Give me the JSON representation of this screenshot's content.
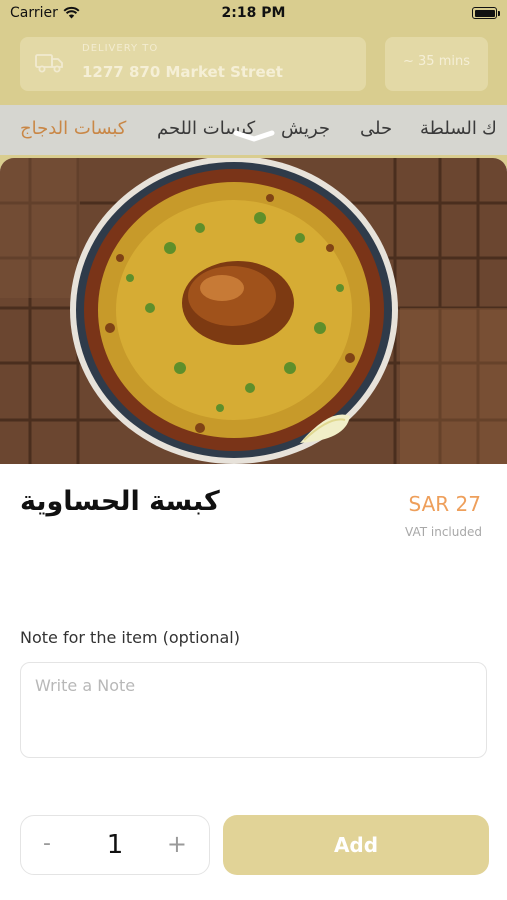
{
  "status_bar": {
    "carrier": "Carrier",
    "time": "2:18 PM"
  },
  "header": {
    "delivery_label": "DELIVERY TO",
    "delivery_address": "1277 870 Market Street",
    "delivery_time": "~ 35 mins"
  },
  "categories": [
    {
      "label": "ﻙ"
    },
    {
      "label": "السلطة"
    },
    {
      "label": "حلى"
    },
    {
      "label": "جريش"
    },
    {
      "label": "كبسات اللحم"
    },
    {
      "label": "كبسات الدجاج",
      "active": true
    }
  ],
  "item": {
    "name": "كبسة الحساوية",
    "price": "SAR 27",
    "vat_note": "VAT included",
    "image_icon": "kabsa-dish-image"
  },
  "note": {
    "label": "Note for the item (optional)",
    "placeholder": "Write a Note",
    "value": ""
  },
  "quantity": {
    "minus": "-",
    "value": "1",
    "plus": "+"
  },
  "add_button": {
    "label": "Add"
  },
  "colors": {
    "accent_price": "#ee9f5b",
    "add_button": "#e1d397",
    "active_tab": "#c98746"
  }
}
